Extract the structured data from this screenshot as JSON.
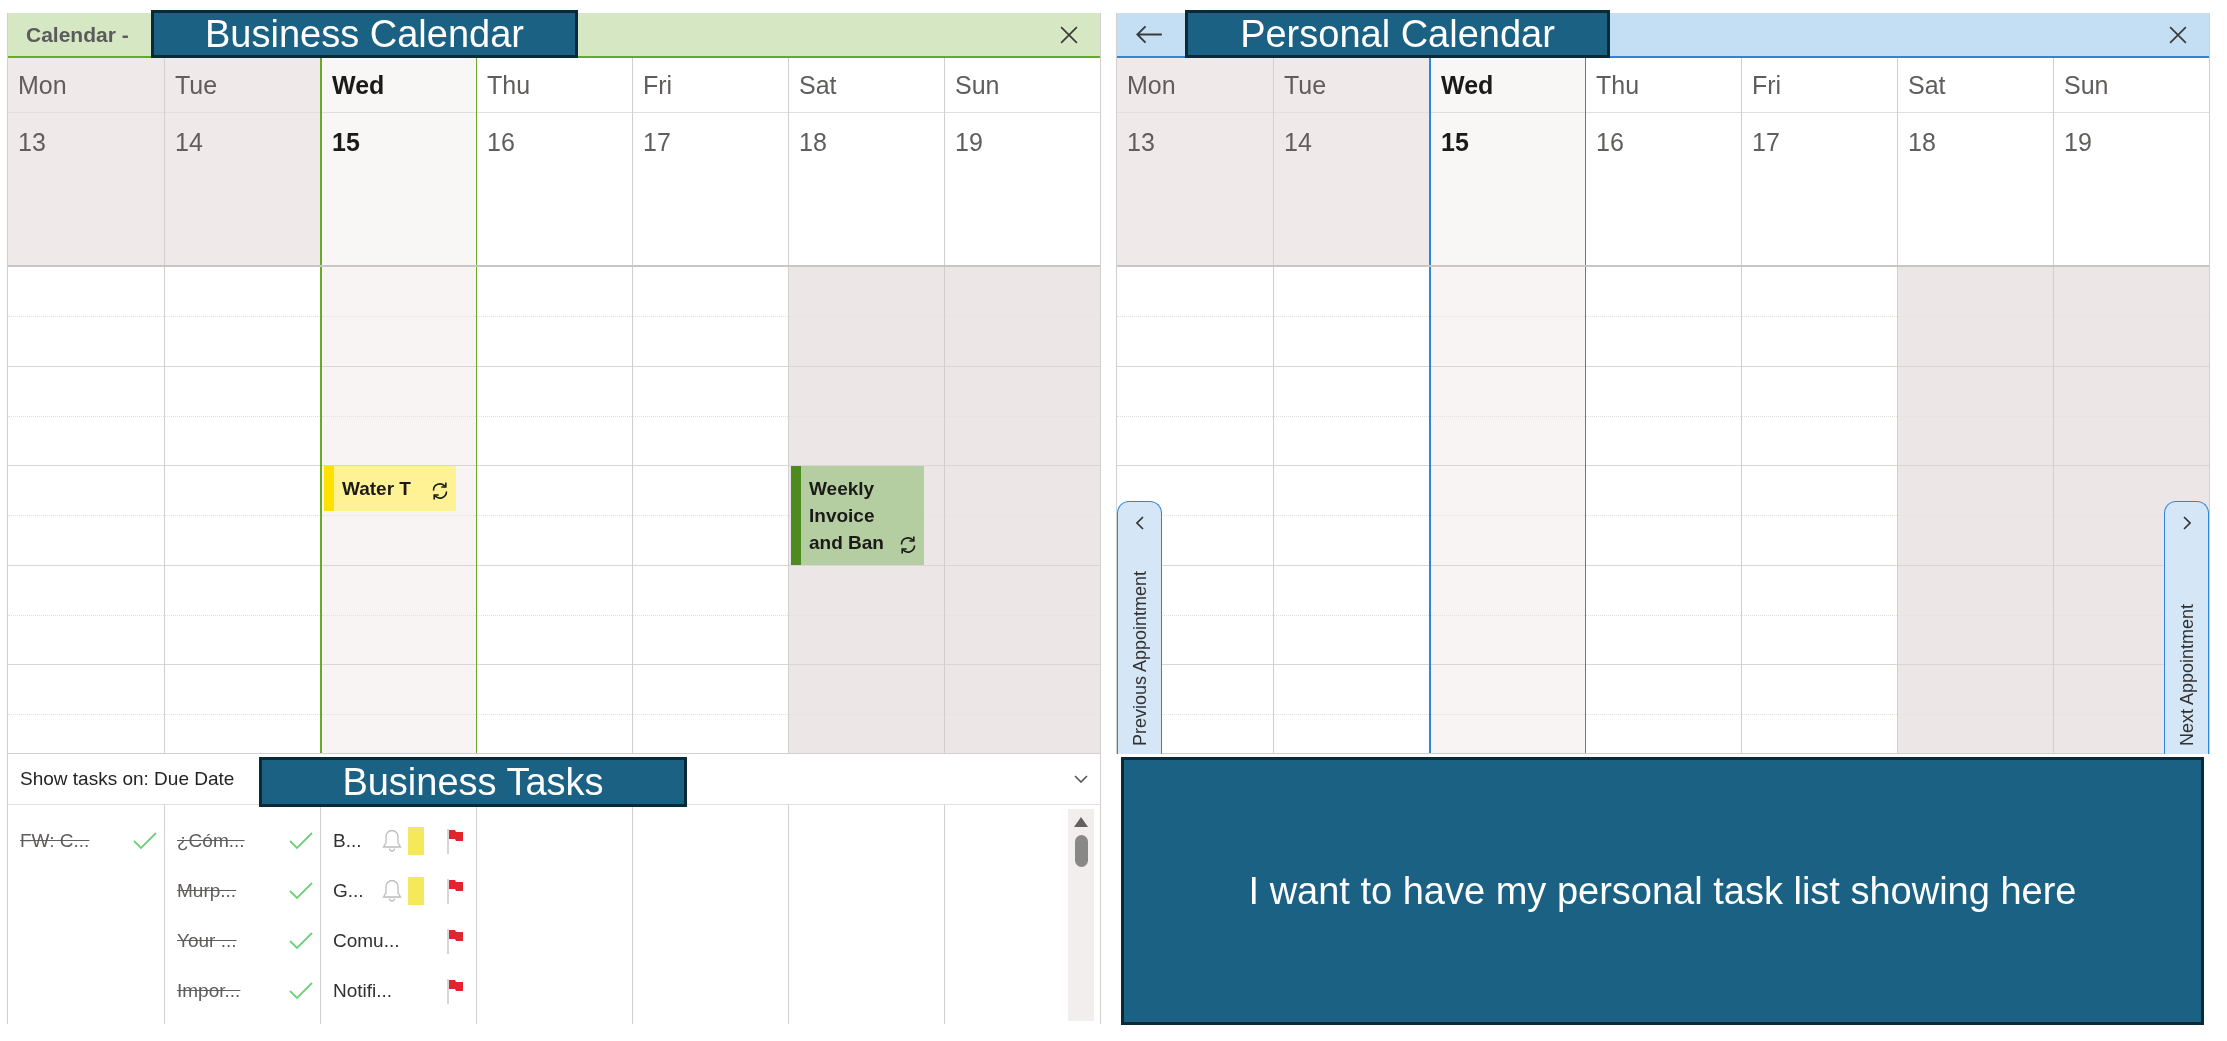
{
  "calendars": [
    {
      "kind": "main",
      "color": "#6aa82a",
      "title": "Calendar -",
      "annotation": "Business Calendar",
      "days": [
        {
          "name": "Mon",
          "date": "13",
          "past": true,
          "today": false,
          "weekend": false
        },
        {
          "name": "Tue",
          "date": "14",
          "past": true,
          "today": false,
          "weekend": false
        },
        {
          "name": "Wed",
          "date": "15",
          "past": false,
          "today": true,
          "weekend": false,
          "events": [
            {
              "title": "Water T",
              "color": "#ffe100",
              "recurring": true
            }
          ]
        },
        {
          "name": "Thu",
          "date": "16",
          "past": false,
          "today": false,
          "weekend": false
        },
        {
          "name": "Fri",
          "date": "17",
          "past": false,
          "today": false,
          "weekend": false
        },
        {
          "name": "Sat",
          "date": "18",
          "past": false,
          "today": false,
          "weekend": true,
          "events": [
            {
              "title": "Weekly Invoice and Ban",
              "color": "#4e8b1f",
              "recurring": true
            }
          ]
        },
        {
          "name": "Sun",
          "date": "19",
          "past": false,
          "today": false,
          "weekend": true
        }
      ],
      "tasks": {
        "label": "Show tasks on: Due Date",
        "annotation": "Business Tasks",
        "columns": [
          {
            "items": [
              {
                "title": "FW: C...",
                "completed": true,
                "reminder": false
              }
            ]
          },
          {
            "items": [
              {
                "title": "¿Cóm...",
                "completed": true,
                "reminder": false
              },
              {
                "title": "Murp...",
                "completed": true,
                "reminder": false
              },
              {
                "title": "Your ...",
                "completed": true,
                "reminder": false
              },
              {
                "title": "Impor...",
                "completed": true,
                "reminder": false
              }
            ]
          },
          {
            "items": [
              {
                "title": "B...",
                "completed": false,
                "reminder": true,
                "color": "#f5e85a"
              },
              {
                "title": "G...",
                "completed": false,
                "reminder": true,
                "color": "#f5e85a"
              },
              {
                "title": "Comu...",
                "completed": false,
                "reminder": false
              },
              {
                "title": "Notifi...",
                "completed": false,
                "reminder": false
              }
            ]
          }
        ]
      }
    },
    {
      "kind": "secondary",
      "color": "#2b88d8",
      "annotation": "Personal Calendar",
      "days": [
        {
          "name": "Mon",
          "date": "13",
          "past": true,
          "today": false,
          "weekend": false
        },
        {
          "name": "Tue",
          "date": "14",
          "past": true,
          "today": false,
          "weekend": false
        },
        {
          "name": "Wed",
          "date": "15",
          "past": false,
          "today": true,
          "weekend": false
        },
        {
          "name": "Thu",
          "date": "16",
          "past": false,
          "today": false,
          "weekend": false
        },
        {
          "name": "Fri",
          "date": "17",
          "past": false,
          "today": false,
          "weekend": false
        },
        {
          "name": "Sat",
          "date": "18",
          "past": false,
          "today": false,
          "weekend": true
        },
        {
          "name": "Sun",
          "date": "19",
          "past": false,
          "today": false,
          "weekend": true
        }
      ],
      "previous": "Previous Appointment",
      "next": "Next Appointment",
      "note": "I want to have my personal task list showing here"
    }
  ]
}
